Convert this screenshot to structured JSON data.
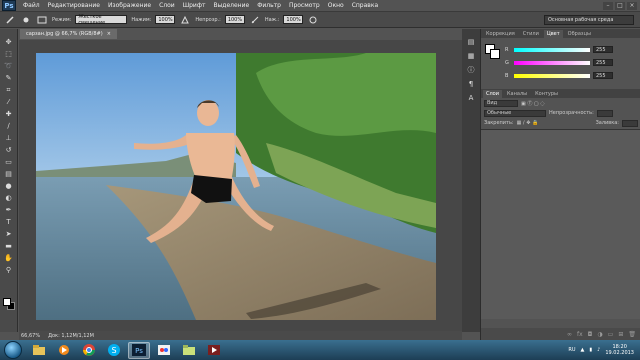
{
  "app": {
    "logo": "Ps",
    "menu": [
      "Файл",
      "Редактирование",
      "Изображение",
      "Слои",
      "Шрифт",
      "Выделение",
      "Фильтр",
      "Просмотр",
      "Окно",
      "Справка"
    ],
    "window_controls": [
      "minimize-icon",
      "maximize-icon",
      "close-icon"
    ]
  },
  "options": {
    "mode_label": "Режим:",
    "mode_value": "Жесткое смешение",
    "pressure_label": "Нажим:",
    "pressure_value": "100%",
    "opacity_label": "Непрозр.:",
    "opacity_value": "100%",
    "flow_label": "Наж.:",
    "flow_value": "100%",
    "workspace": "Основная рабочая среда"
  },
  "document": {
    "tab_title": "сарзан.jpg @ 66,7% (RGB/8#)",
    "zoom": "66,67%",
    "doc_size": "Док: 1,12M/1,12M"
  },
  "color_panel": {
    "tabs": [
      "Коррекция",
      "Стили",
      "Цвет",
      "Образцы"
    ],
    "active_tab": "Цвет",
    "sliders": [
      {
        "letter": "R",
        "value": "255"
      },
      {
        "letter": "G",
        "value": "255"
      },
      {
        "letter": "B",
        "value": "255"
      }
    ]
  },
  "layers_panel": {
    "tabs": [
      "Слои",
      "Каналы",
      "Контуры"
    ],
    "active_tab": "Слои",
    "kind_label": "Вид",
    "blend_mode": "Обычные",
    "opacity_label": "Непрозрачность:",
    "lock_label": "Закрепить:",
    "fill_label": "Заливка:"
  },
  "taskbar": {
    "apps": [
      "explorer-icon",
      "media-player-icon",
      "chrome-icon",
      "skype-icon",
      "photoshop-icon",
      "paint-icon",
      "folder-icon",
      "video-icon"
    ],
    "active_app": "photoshop-icon",
    "language": "RU",
    "time": "18:20",
    "date": "19.02.2013"
  }
}
